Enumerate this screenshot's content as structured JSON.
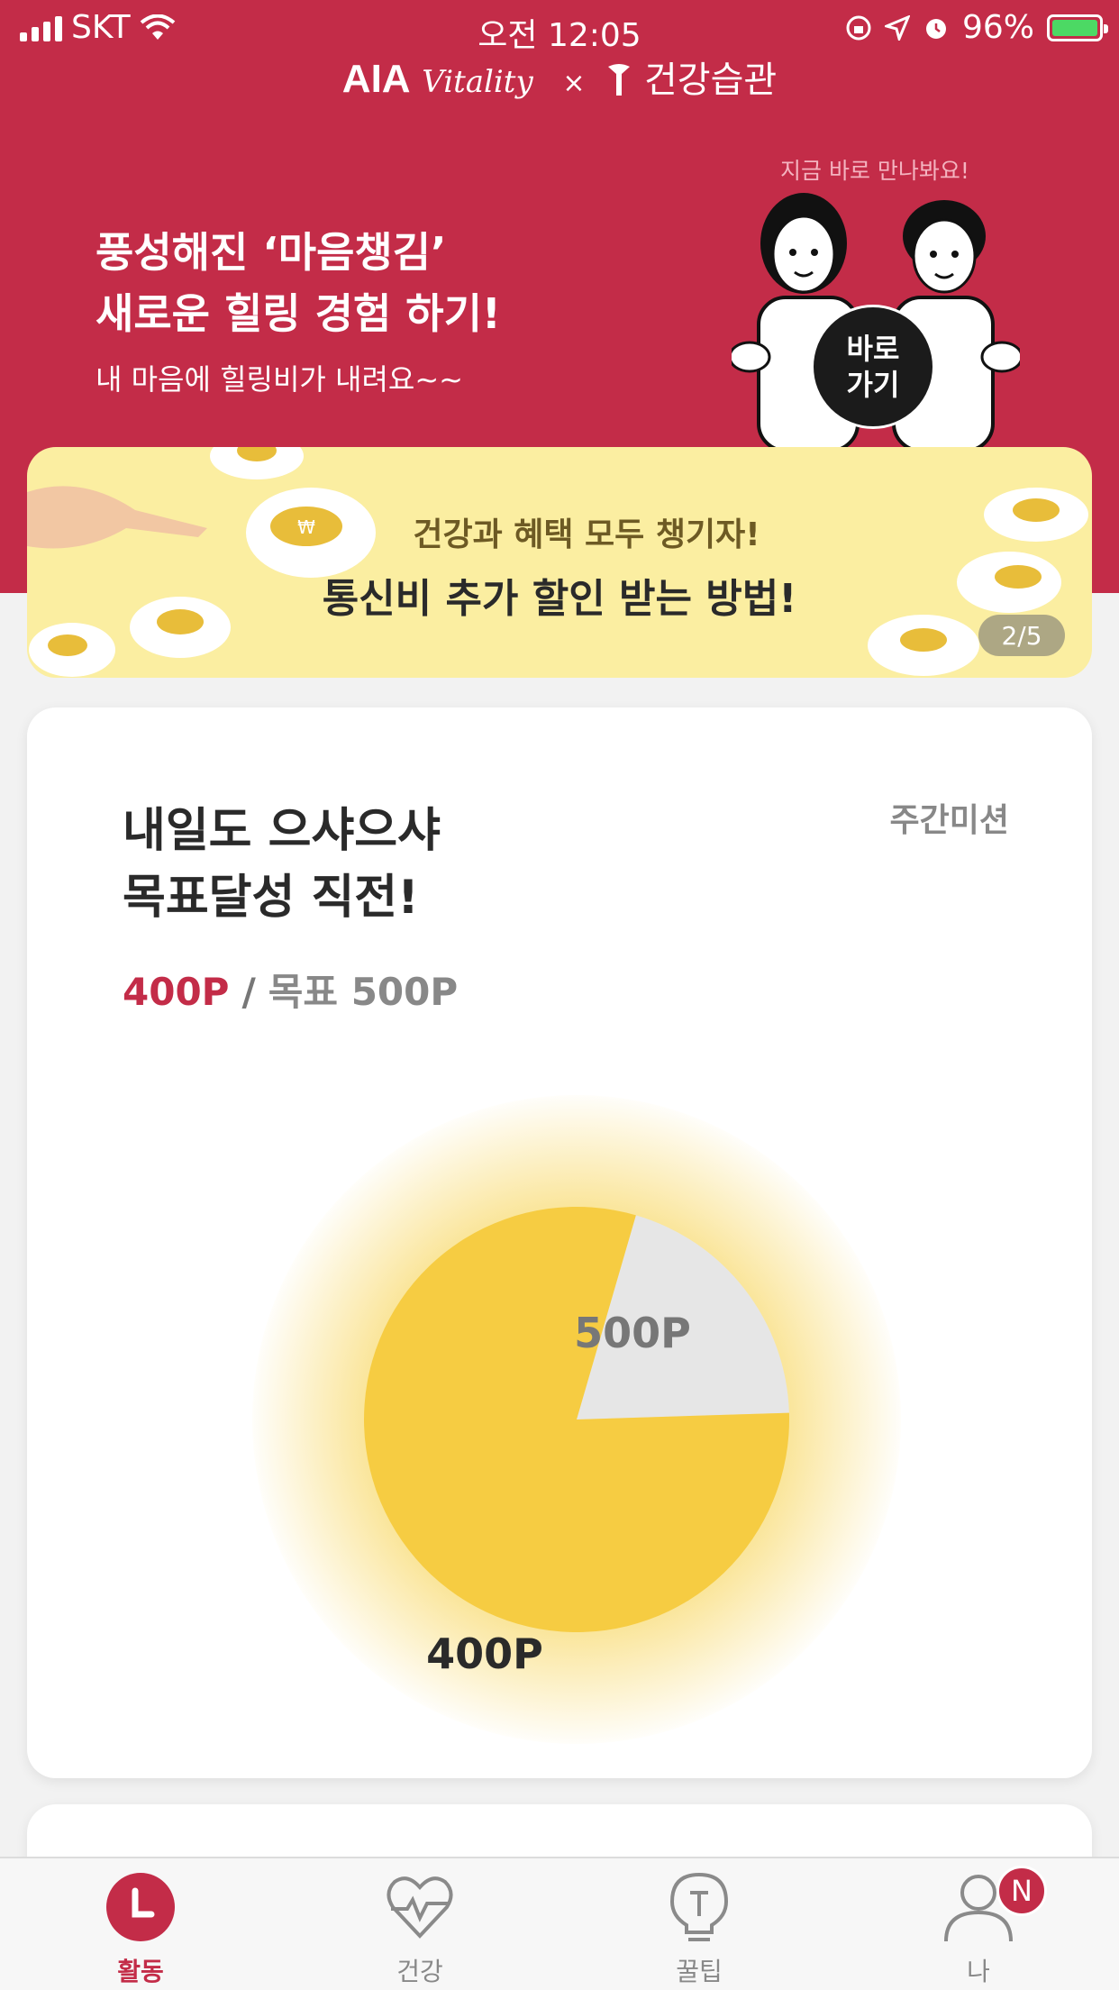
{
  "status_bar": {
    "carrier": "SKT",
    "time": "오전 12:05",
    "battery": "96%"
  },
  "brand": {
    "aia": "AIA",
    "vitality": "Vitality",
    "times": "×",
    "partner": "건강습관"
  },
  "hero": {
    "title_line1": "풍성해진 ‘마음챙김’",
    "title_line2": "새로운 힐링 경험 하기!",
    "subtitle": "내 마음에 힐링비가 내려요~~",
    "meet_text": "지금 바로 만나봐요!",
    "go_line1": "바로",
    "go_line2": "가기"
  },
  "banner": {
    "line1": "건강과 혜택 모두 챙기자!",
    "line2": "통신비 추가 할인 받는 방법!",
    "pager": "2/5"
  },
  "mission": {
    "title_line1": "내일도 으샤으샤",
    "title_line2": "목표달성 직전!",
    "tag": "주간미션",
    "current": "400P",
    "separator": "/",
    "goal": "목표 500P",
    "colors": {
      "achieved": "#f6cc42",
      "remaining": "#e6e6e6",
      "accent": "#c32c48"
    }
  },
  "chart_data": {
    "type": "pie",
    "slices": [
      {
        "label": "400P",
        "value": 400
      },
      {
        "label": "500P",
        "value": 100
      }
    ],
    "goal": 500
  },
  "tabs": [
    {
      "label": "활동",
      "icon": "clock-icon",
      "active": true
    },
    {
      "label": "건강",
      "icon": "heart-pulse-icon",
      "active": false
    },
    {
      "label": "꿀팁",
      "icon": "lightbulb-icon",
      "active": false
    },
    {
      "label": "나",
      "icon": "person-icon",
      "active": false,
      "badge": "N"
    }
  ]
}
